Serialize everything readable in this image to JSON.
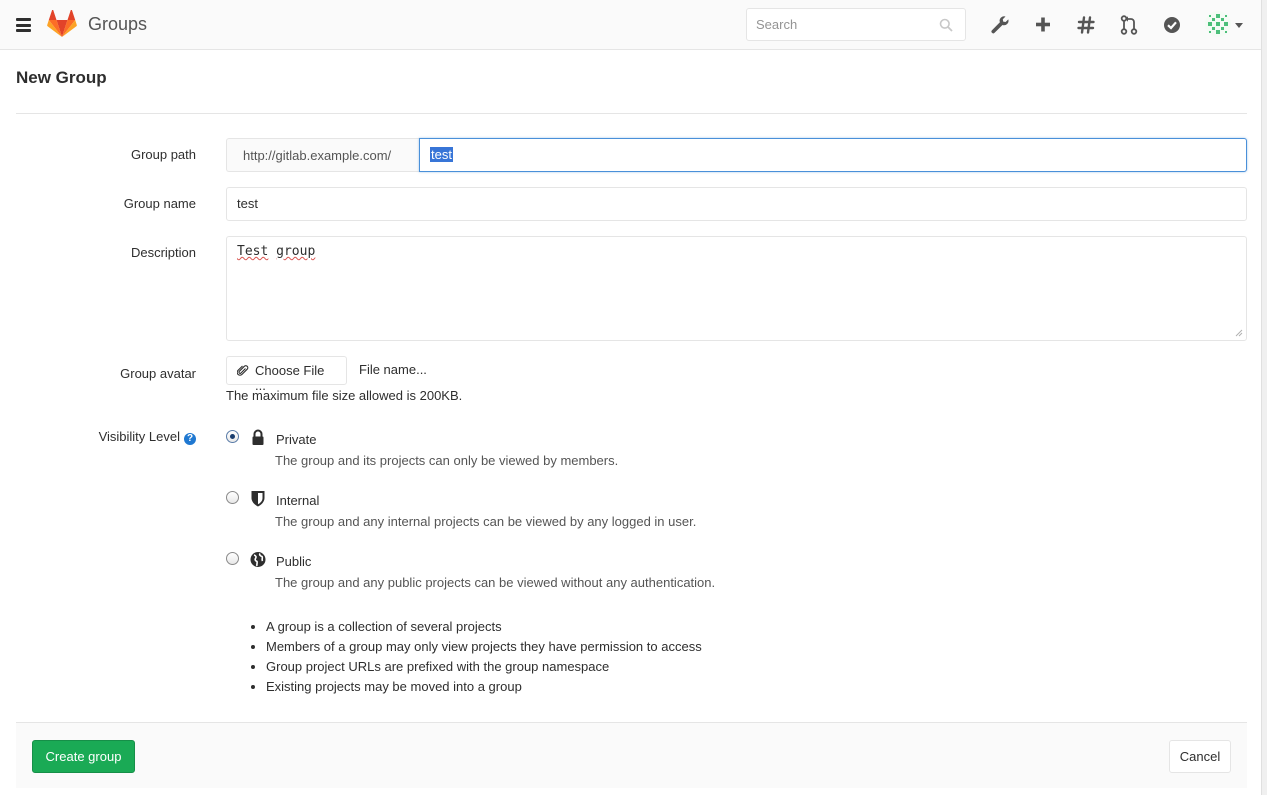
{
  "navbar": {
    "title": "Groups",
    "search_placeholder": "Search",
    "icons": [
      "menu-icon",
      "gitlab-logo",
      "search-icon",
      "wrench-icon",
      "plus-icon",
      "hash-icon",
      "merge-request-icon",
      "todo-check-icon",
      "user-avatar",
      "caret-down-icon"
    ]
  },
  "page": {
    "title": "New Group"
  },
  "form": {
    "group_path": {
      "label": "Group path",
      "prefix": "http://gitlab.example.com/",
      "value": "test"
    },
    "group_name": {
      "label": "Group name",
      "value": "test"
    },
    "description": {
      "label": "Description",
      "value_word1": "Test",
      "value_word2": "group"
    },
    "avatar": {
      "label": "Group avatar",
      "button_label": "Choose File ...",
      "file_name": "File name...",
      "help": "The maximum file size allowed is 200KB."
    },
    "visibility": {
      "label": "Visibility Level",
      "help_icon": "?",
      "options": [
        {
          "title": "Private",
          "description": "The group and its projects can only be viewed by members.",
          "icon": "lock-icon",
          "checked": true
        },
        {
          "title": "Internal",
          "description": "The group and any internal projects can be viewed by any logged in user.",
          "icon": "shield-icon",
          "checked": false
        },
        {
          "title": "Public",
          "description": "The group and any public projects can be viewed without any authentication.",
          "icon": "globe-icon",
          "checked": false
        }
      ]
    },
    "info_bullets": [
      "A group is a collection of several projects",
      "Members of a group may only view projects they have permission to access",
      "Group project URLs are prefixed with the group namespace",
      "Existing projects may be moved into a group"
    ]
  },
  "actions": {
    "create_label": "Create group",
    "cancel_label": "Cancel"
  },
  "colors": {
    "create_button": "#1aaa55",
    "focus_border": "#4a90d9",
    "help_icon": "#1f78d1",
    "logo_orange": "#fc6d26"
  }
}
